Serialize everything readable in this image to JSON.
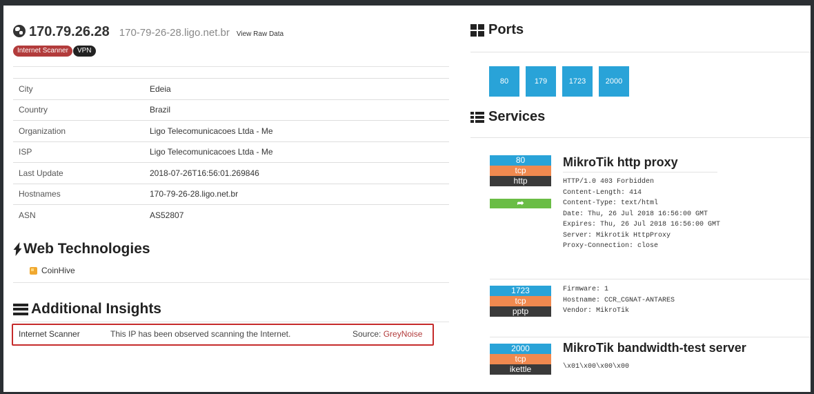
{
  "header": {
    "ip": "170.79.26.28",
    "hostname": "170-79-26-28.ligo.net.br",
    "raw_link": "View Raw Data",
    "tags": [
      "Internet Scanner",
      "VPN"
    ]
  },
  "info": {
    "rows": [
      {
        "key": "City",
        "value": "Edeia"
      },
      {
        "key": "Country",
        "value": "Brazil"
      },
      {
        "key": "Organization",
        "value": "Ligo Telecomunicacoes Ltda - Me"
      },
      {
        "key": "ISP",
        "value": "Ligo Telecomunicacoes Ltda - Me"
      },
      {
        "key": "Last Update",
        "value": "2018-07-26T16:56:01.269846"
      },
      {
        "key": "Hostnames",
        "value": "170-79-26-28.ligo.net.br"
      },
      {
        "key": "ASN",
        "value": "AS52807"
      }
    ]
  },
  "web_tech": {
    "title": "Web Technologies",
    "items": [
      "CoinHive"
    ]
  },
  "insights": {
    "title": "Additional Insights",
    "row": {
      "key": "Internet Scanner",
      "description": "This IP has been observed scanning the Internet.",
      "source_label": "Source:",
      "source": "GreyNoise"
    }
  },
  "ports": {
    "title": "Ports",
    "list": [
      "80",
      "179",
      "1723",
      "2000"
    ]
  },
  "services": {
    "title": "Services",
    "items": [
      {
        "port": "80",
        "proto": "tcp",
        "name": "http",
        "title": "MikroTik http proxy",
        "lines": [
          "HTTP/1.0 403 Forbidden",
          "Content-Length: 414",
          "Content-Type: text/html",
          "Date: Thu, 26 Jul 2018 16:56:00 GMT",
          "Expires: Thu, 26 Jul 2018 16:56:00 GMT",
          "Server: Mikrotik HttpProxy",
          "Proxy-Connection: close"
        ]
      },
      {
        "port": "1723",
        "proto": "tcp",
        "name": "pptp",
        "title": "",
        "lines": [
          "Firmware: 1",
          "Hostname: CCR_CGNAT-ANTARES",
          "Vendor: MikroTik"
        ]
      },
      {
        "port": "2000",
        "proto": "tcp",
        "name": "ikettle",
        "title": "MikroTik bandwidth-test server",
        "lines": [
          "\\x01\\x00\\x00\\x00"
        ]
      }
    ]
  },
  "colors": {
    "accent_blue": "#29a3d8",
    "proto_orange": "#f0894f",
    "tag_red": "#b23b3b",
    "go_green": "#6abd45",
    "highlight_red": "#c52a2a"
  }
}
